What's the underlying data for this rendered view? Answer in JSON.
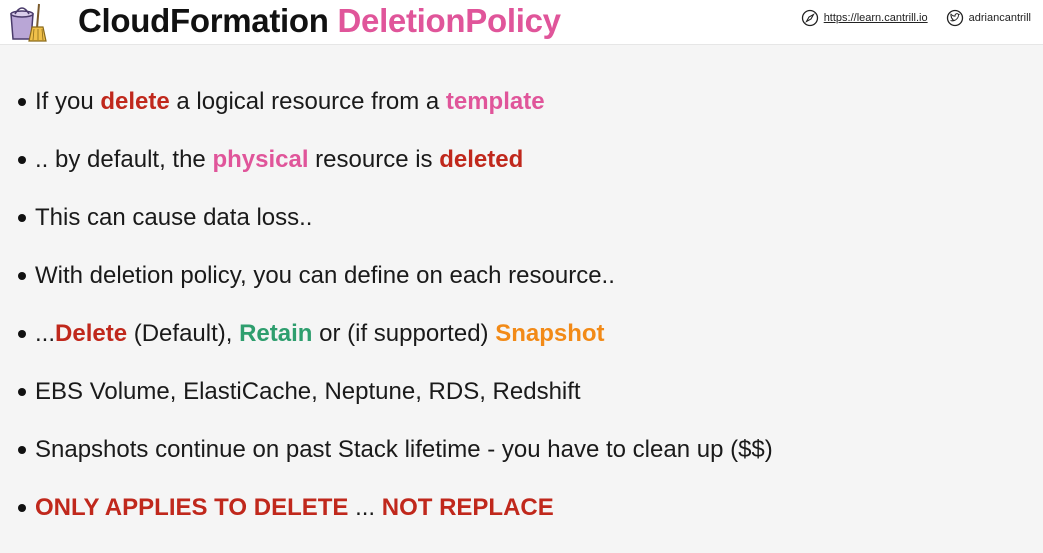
{
  "header": {
    "title_main": "CloudFormation",
    "title_accent": "DeletionPolicy",
    "website_url": "https://learn.cantrill.io",
    "twitter_handle": "adriancantrill",
    "logo_icon": "bucket-broom-icon",
    "website_icon": "compass-icon",
    "twitter_icon": "twitter-bird-icon"
  },
  "colors": {
    "red": "#c0281c",
    "pink": "#e0559a",
    "green": "#2e9e6e",
    "orange": "#f28a17"
  },
  "bullets": [
    {
      "segments": [
        {
          "text": "If you ",
          "style": "normal"
        },
        {
          "text": "delete",
          "style": "red"
        },
        {
          "text": " a logical resource from a ",
          "style": "normal"
        },
        {
          "text": "template",
          "style": "pink"
        }
      ]
    },
    {
      "segments": [
        {
          "text": ".. by default, the ",
          "style": "normal"
        },
        {
          "text": "physical",
          "style": "pink"
        },
        {
          "text": " resource is ",
          "style": "normal"
        },
        {
          "text": "deleted",
          "style": "red"
        }
      ]
    },
    {
      "segments": [
        {
          "text": "This can cause data loss..",
          "style": "normal"
        }
      ]
    },
    {
      "segments": [
        {
          "text": "With deletion policy, you can define on each resource..",
          "style": "normal"
        }
      ]
    },
    {
      "segments": [
        {
          "text": "...",
          "style": "normal"
        },
        {
          "text": "Delete",
          "style": "red"
        },
        {
          "text": " (Default), ",
          "style": "normal"
        },
        {
          "text": "Retain",
          "style": "green"
        },
        {
          "text": " or (if supported) ",
          "style": "normal"
        },
        {
          "text": "Snapshot",
          "style": "orange"
        }
      ]
    },
    {
      "segments": [
        {
          "text": "EBS Volume, ElastiCache, Neptune, RDS, Redshift",
          "style": "normal"
        }
      ]
    },
    {
      "segments": [
        {
          "text": "Snapshots continue on past Stack lifetime - you have to clean up ($$)",
          "style": "normal"
        }
      ]
    },
    {
      "segments": [
        {
          "text": "ONLY APPLIES TO DELETE",
          "style": "red"
        },
        {
          "text": " ... ",
          "style": "normal"
        },
        {
          "text": "NOT REPLACE",
          "style": "red"
        }
      ]
    }
  ]
}
